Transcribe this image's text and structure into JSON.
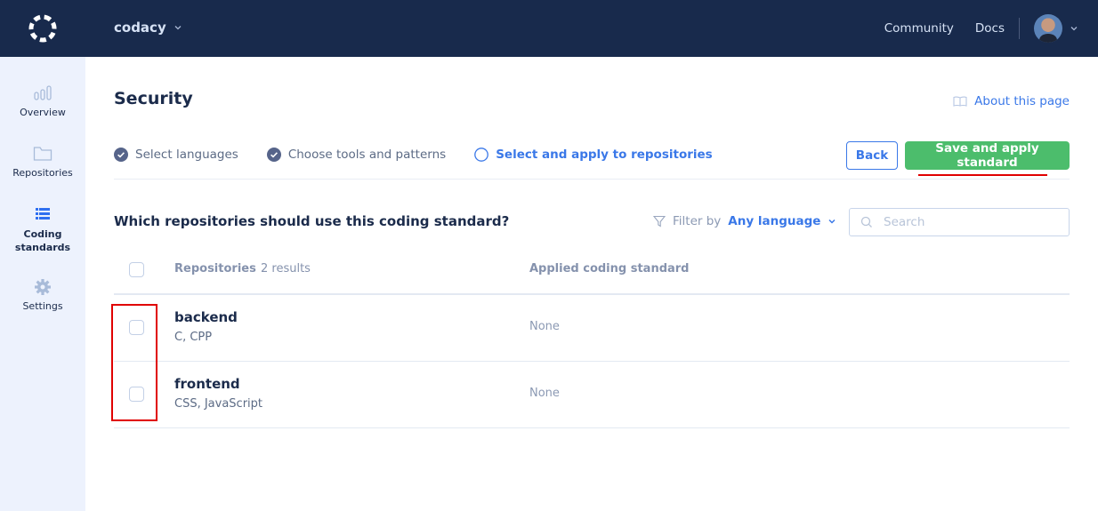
{
  "topbar": {
    "logo_icon": "codacy-logo-icon",
    "org_name": "codacy",
    "links": [
      "Community",
      "Docs"
    ],
    "avatar": "user-avatar"
  },
  "sidebar": {
    "items": [
      {
        "label": "Overview",
        "icon": "bar-chart-icon",
        "active": false
      },
      {
        "label": "Repositories",
        "icon": "folder-icon",
        "active": false
      },
      {
        "label": "Coding standards",
        "icon": "list-icon",
        "active": true
      },
      {
        "label": "Settings",
        "icon": "gear-icon",
        "active": false
      }
    ]
  },
  "page": {
    "title": "Security",
    "about_link": "About this page"
  },
  "steps": [
    {
      "label": "Select languages",
      "status": "done"
    },
    {
      "label": "Choose tools and patterns",
      "status": "done"
    },
    {
      "label": "Select and apply to repositories",
      "status": "current"
    }
  ],
  "actions": {
    "back_label": "Back",
    "save_label": "Save and apply standard"
  },
  "section": {
    "question": "Which repositories should use this coding standard?",
    "filter_label": "Filter by",
    "filter_value": "Any language",
    "search_placeholder": "Search"
  },
  "table": {
    "headers": {
      "repositories": "Repositories",
      "results": "2 results",
      "applied": "Applied coding standard"
    },
    "rows": [
      {
        "name": "backend",
        "languages": "C, CPP",
        "standard": "None",
        "checked": false
      },
      {
        "name": "frontend",
        "languages": "CSS, JavaScript",
        "standard": "None",
        "checked": false
      }
    ]
  },
  "colors": {
    "topbar_bg": "#182a4c",
    "sidebar_bg": "#edf2fd",
    "accent_blue": "#3a78e8",
    "primary_green": "#4cbd6c",
    "annotation_red": "#e00000"
  }
}
